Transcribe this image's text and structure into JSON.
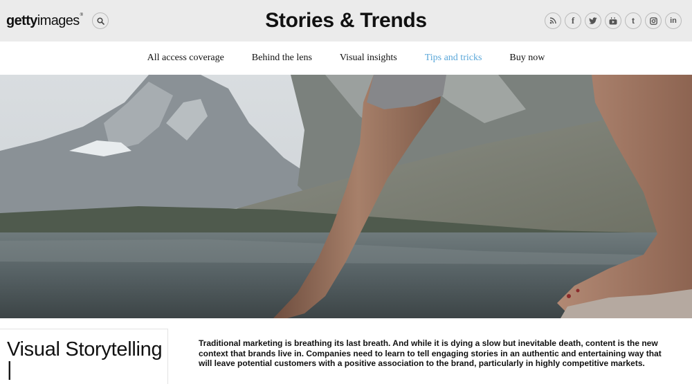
{
  "header": {
    "logo": {
      "part1": "getty",
      "part2": "images",
      "mark": "®"
    },
    "search_icon": "search-icon",
    "site_title": "Stories & Trends",
    "social": [
      {
        "icon": "rss-icon",
        "glyph": "∷"
      },
      {
        "icon": "facebook-icon",
        "glyph": "f"
      },
      {
        "icon": "twitter-icon",
        "glyph": "t"
      },
      {
        "icon": "youtube-icon",
        "glyph": "▶"
      },
      {
        "icon": "tumblr-icon",
        "glyph": "t"
      },
      {
        "icon": "instagram-icon",
        "glyph": "▢"
      },
      {
        "icon": "linkedin-icon",
        "glyph": "in"
      }
    ]
  },
  "nav": {
    "items": [
      {
        "label": "All access coverage"
      },
      {
        "label": "Behind the lens"
      },
      {
        "label": "Visual insights"
      },
      {
        "label": "Tips and tricks",
        "active": true
      },
      {
        "label": "Buy now"
      }
    ],
    "active_color": "#5aa7d9"
  },
  "article": {
    "headline": "Visual Storytelling |",
    "intro": "Traditional marketing is breathing its last breath. And while it is dying a slow but inevitable death, content is the new context that brands live in. Companies need to learn to tell engaging stories in an authentic and entertaining way that will leave potential customers with a positive association to the brand, particularly in highly competitive markets."
  },
  "colors": {
    "header_bg": "#ebebeb",
    "accent": "#5aa7d9"
  }
}
